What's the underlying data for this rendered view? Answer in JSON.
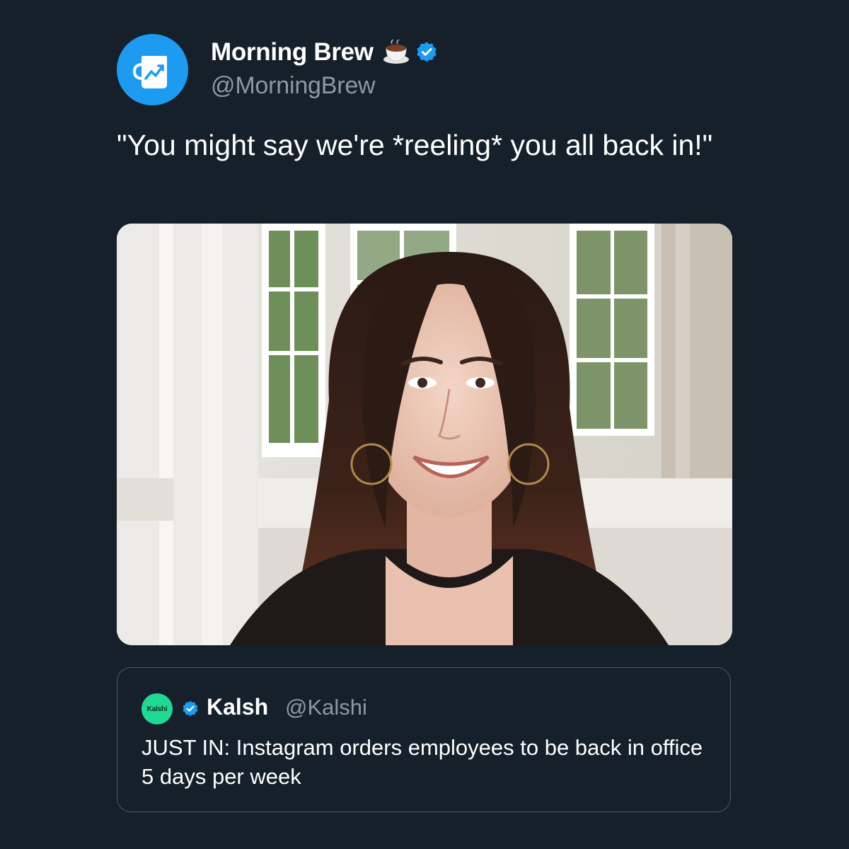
{
  "colors": {
    "background": "#15202b",
    "accent": "#1d9bf0",
    "secondary_text": "#8b98a5",
    "kalshi_green": "#1fd993"
  },
  "tweet": {
    "author": {
      "name": "Morning Brew",
      "handle": "@MorningBrew",
      "avatar_icon": "mug-chart-icon",
      "name_emoji_icon": "coffee-cup-icon",
      "verified_icon": "verified-badge-icon"
    },
    "text": "\"You might say we're *reeling* you all back in!\"",
    "media": {
      "kind": "photo"
    }
  },
  "quote": {
    "avatar_text": "Kalshi",
    "verified_icon": "verified-badge-icon",
    "name": "Kalsh",
    "handle": "@Kalshi",
    "text": "JUST IN: Instagram orders employees to be back in office 5 days per week"
  }
}
